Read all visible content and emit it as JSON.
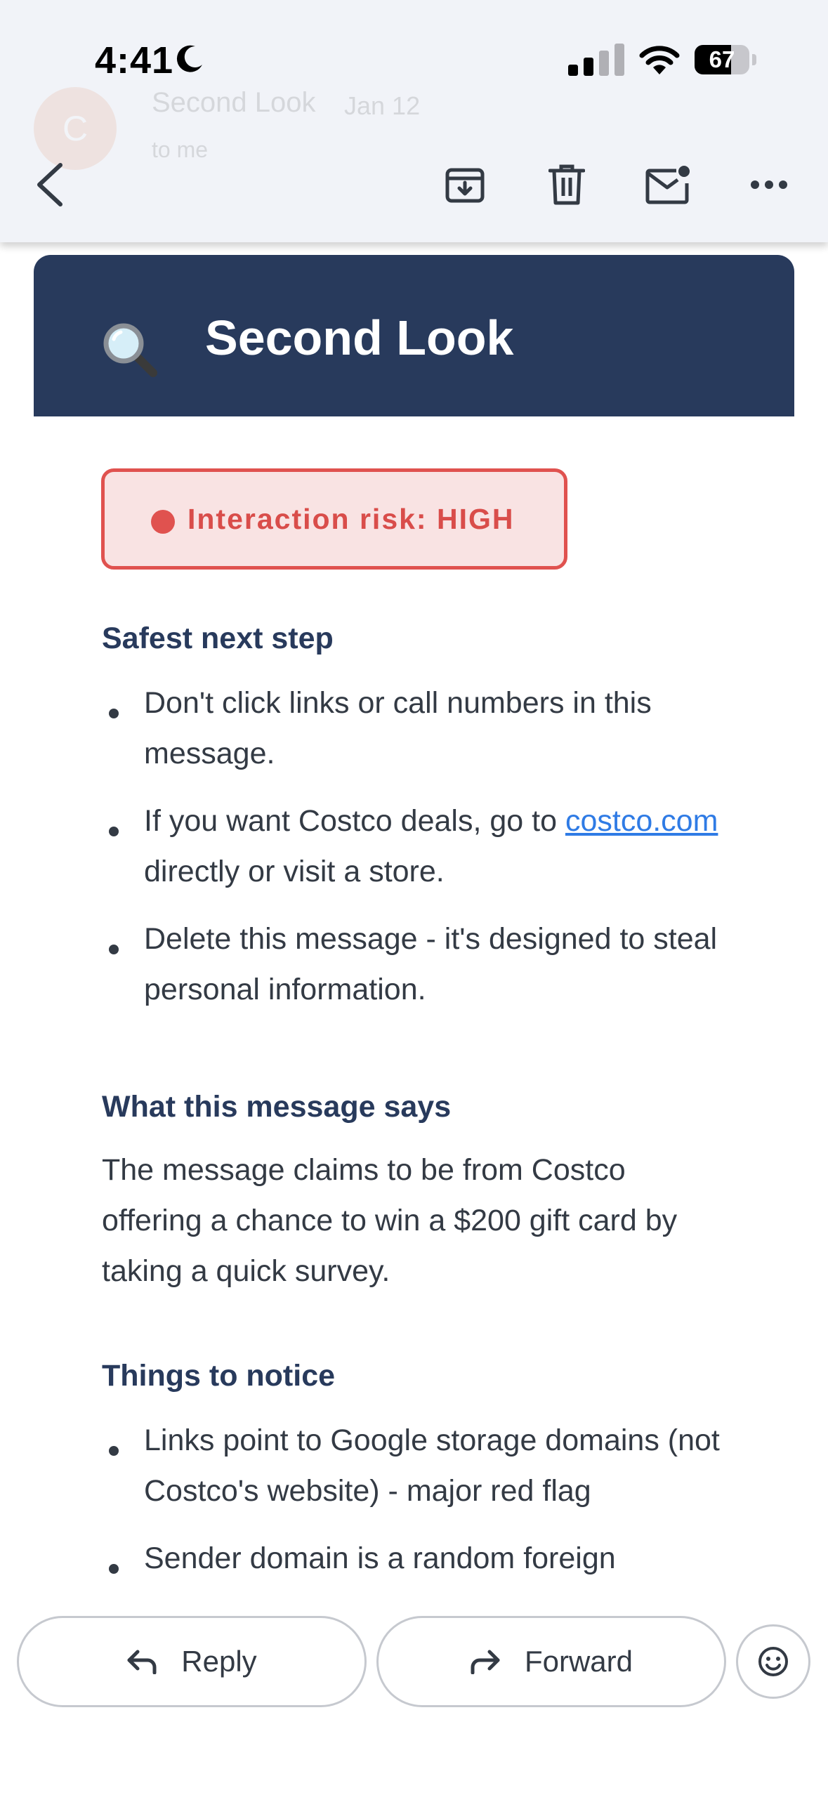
{
  "status_bar": {
    "time": "4:41",
    "battery_level": "67"
  },
  "ghost_header": {
    "avatar_initial": "C",
    "sender": "Second Look",
    "date": "Jan 12",
    "recipient": "to me"
  },
  "banner": {
    "icon": "magnifying-glass-icon",
    "title": "Second Look",
    "color": "#283a5c"
  },
  "risk": {
    "label": "Interaction risk: HIGH",
    "color": "#e0524f"
  },
  "safest_next_step": {
    "title": "Safest next step",
    "item1": "Don't click links or call numbers in this message.",
    "item2_before": "If you want Costco deals, go to ",
    "item2_link": "costco.com",
    "item2_after": " directly or visit a store.",
    "item3": "Delete this message - it's designed to steal personal information."
  },
  "what_it_says": {
    "title": "What this message says",
    "body": "The message claims to be from Costco offering a chance to win a $200 gift card by taking a quick survey."
  },
  "things_to_notice": {
    "title": "Things to notice",
    "item1": "Links point to Google storage domains (not Costco's website) - major red flag",
    "item2": "Sender domain is a random foreign"
  },
  "actions": {
    "reply": "Reply",
    "forward": "Forward"
  }
}
